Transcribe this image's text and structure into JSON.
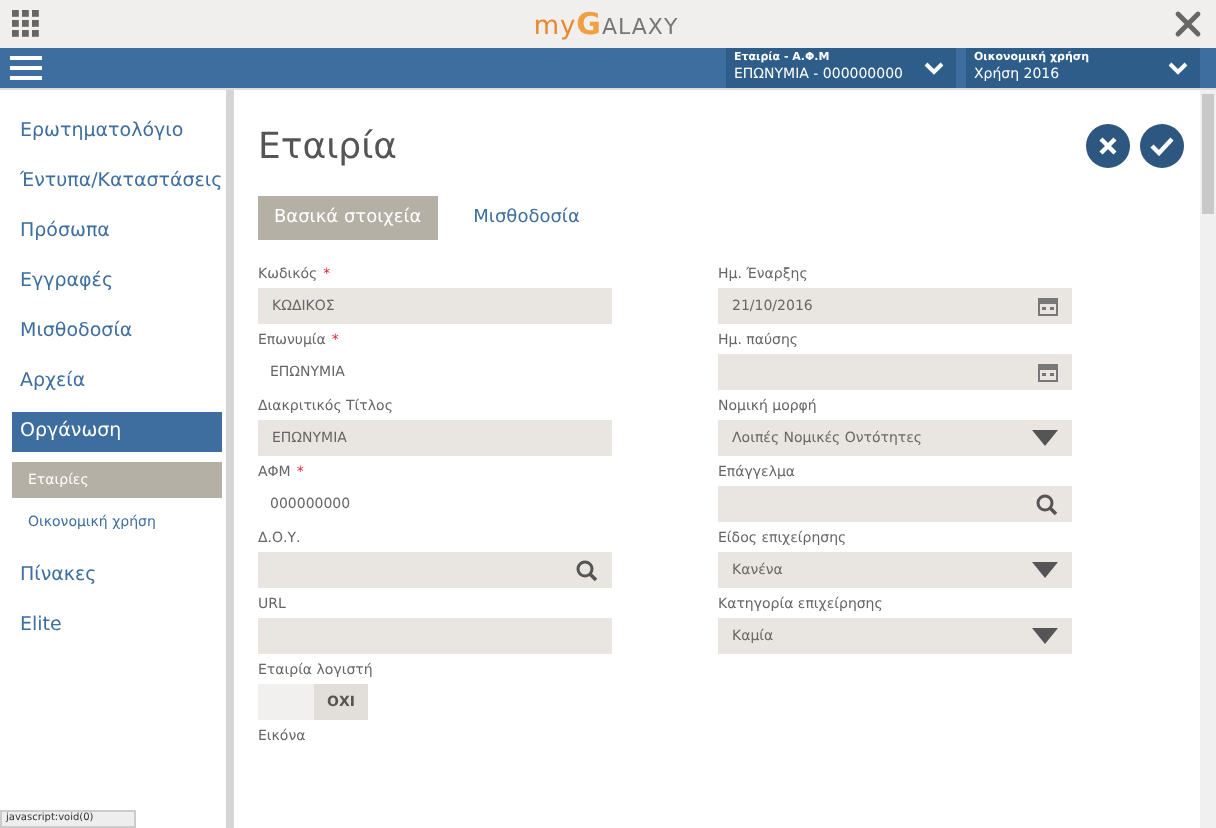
{
  "logo": {
    "prefix": "my",
    "letter": "G",
    "rest": "ALAXY"
  },
  "header": {
    "selectors": [
      {
        "label": "Εταιρία - Α.Φ.Μ",
        "value": "ΕΠΩΝΥΜΙΑ - 000000000"
      },
      {
        "label": "Οικονομική χρήση",
        "value": "Χρήση 2016"
      }
    ]
  },
  "sidebar": {
    "items": [
      {
        "label": "Ερωτηματολόγιο",
        "selected": false
      },
      {
        "label": "Έντυπα/Καταστάσεις",
        "selected": false
      },
      {
        "label": "Πρόσωπα",
        "selected": false
      },
      {
        "label": "Εγγραφές",
        "selected": false
      },
      {
        "label": "Μισθοδοσία",
        "selected": false
      },
      {
        "label": "Αρχεία",
        "selected": false
      },
      {
        "label": "Οργάνωση",
        "selected": true,
        "children": [
          {
            "label": "Εταιρίες",
            "selected": true
          },
          {
            "label": "Οικονομική χρήση",
            "selected": false
          }
        ]
      },
      {
        "label": "Πίνακες",
        "selected": false
      },
      {
        "label": "Elite",
        "selected": false
      }
    ]
  },
  "page": {
    "title": "Εταιρία"
  },
  "tabs": [
    {
      "label": "Βασικά στοιχεία",
      "selected": true
    },
    {
      "label": "Μισθοδοσία",
      "selected": false
    }
  ],
  "form": {
    "left": [
      {
        "label": "Κωδικός",
        "required_mark": "*",
        "kind": "text",
        "value": "ΚΩΔΙΚΟΣ"
      },
      {
        "label": "Επωνυμία",
        "required_mark": "*",
        "kind": "readonly",
        "value": "ΕΠΩΝΥΜΙΑ"
      },
      {
        "label": "Διακριτικός Τίτλος",
        "kind": "text",
        "value": "ΕΠΩΝΥΜΙΑ"
      },
      {
        "label": "ΑΦΜ",
        "required_mark": "*",
        "kind": "readonly",
        "value": "000000000"
      },
      {
        "label": "Δ.Ο.Υ.",
        "kind": "search"
      },
      {
        "label": "URL",
        "kind": "text"
      },
      {
        "label": "Εταιρία λογιστή",
        "kind": "toggle",
        "value": "ΟΧΙ",
        "on": false
      },
      {
        "label": "Εικόνα",
        "kind": "label"
      }
    ],
    "right": [
      {
        "label": "Ημ. Έναρξης",
        "kind": "date",
        "value": "21/10/2016"
      },
      {
        "label": "Ημ. παύσης",
        "kind": "date"
      },
      {
        "label": "Νομική μορφή",
        "kind": "select",
        "value": "Λοιπές Νομικές Οντότητες"
      },
      {
        "label": "Επάγγελμα",
        "kind": "search"
      },
      {
        "label": "Είδος επιχείρησης",
        "kind": "select",
        "value": "Κανένα"
      },
      {
        "label": "Κατηγορία επιχείρησης",
        "kind": "select",
        "value": "Καμία"
      }
    ]
  },
  "status_bar": {
    "text": "javascript:void(0)"
  }
}
